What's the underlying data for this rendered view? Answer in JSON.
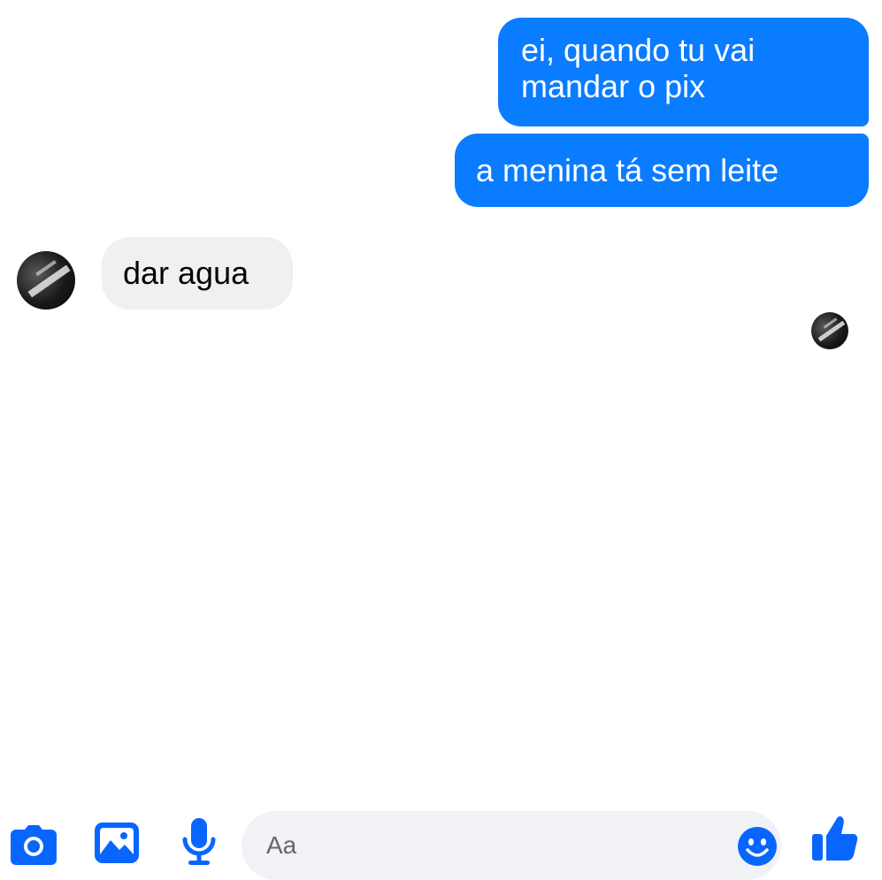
{
  "messages": {
    "outgoing": [
      {
        "text": "ei, quando tu vai\nmandar o pix"
      },
      {
        "text": "a menina tá sem leite"
      }
    ],
    "incoming": [
      {
        "text": "dar agua"
      }
    ]
  },
  "composer": {
    "placeholder": "Aa",
    "icons": [
      "camera-icon",
      "image-icon",
      "microphone-icon",
      "emoji-icon",
      "thumbs-up-icon"
    ]
  },
  "colors": {
    "accent": "#0a7cff",
    "incoming_bubble": "#eef0f2",
    "input_bg": "#f0f2f5",
    "icon_blue": "#0866ff"
  }
}
